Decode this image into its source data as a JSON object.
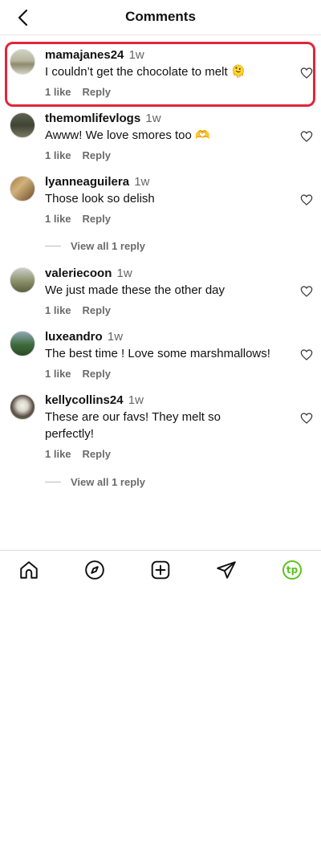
{
  "header": {
    "title": "Comments",
    "back_icon": "chevron-left-icon"
  },
  "comments": [
    {
      "username": "mamajanes24",
      "time": "1w",
      "text": "I couldn’t get the chocolate to melt 🫠",
      "likes": "1 like",
      "reply": "Reply",
      "highlighted": true
    },
    {
      "username": "themomlifevlogs",
      "time": "1w",
      "text": "Awww! We love smores too 🫶",
      "likes": "1 like",
      "reply": "Reply"
    },
    {
      "username": "lyanneaguilera",
      "time": "1w",
      "text": "Those look so delish",
      "likes": "1 like",
      "reply": "Reply",
      "view_replies": "View all 1 reply"
    },
    {
      "username": "valeriecoon",
      "time": "1w",
      "text": "We just made these the other day",
      "likes": "1 like",
      "reply": "Reply"
    },
    {
      "username": "luxeandro",
      "time": "1w",
      "text": "The best time ! Love some marshmallows!",
      "likes": "1 like",
      "reply": "Reply"
    },
    {
      "username": "kellycollins24",
      "time": "1w",
      "text": "These are our favs! They melt so perfectly!",
      "likes": "1 like",
      "reply": "Reply",
      "view_replies": "View all 1 reply"
    }
  ],
  "bottom_nav": {
    "items": [
      "home-icon",
      "explore-compass-icon",
      "create-plus-icon",
      "direct-send-icon",
      "profile-avatar"
    ],
    "profile_initials": "tp"
  },
  "colors": {
    "highlight": "#e0263a",
    "profile_accent": "#5cc21e"
  }
}
